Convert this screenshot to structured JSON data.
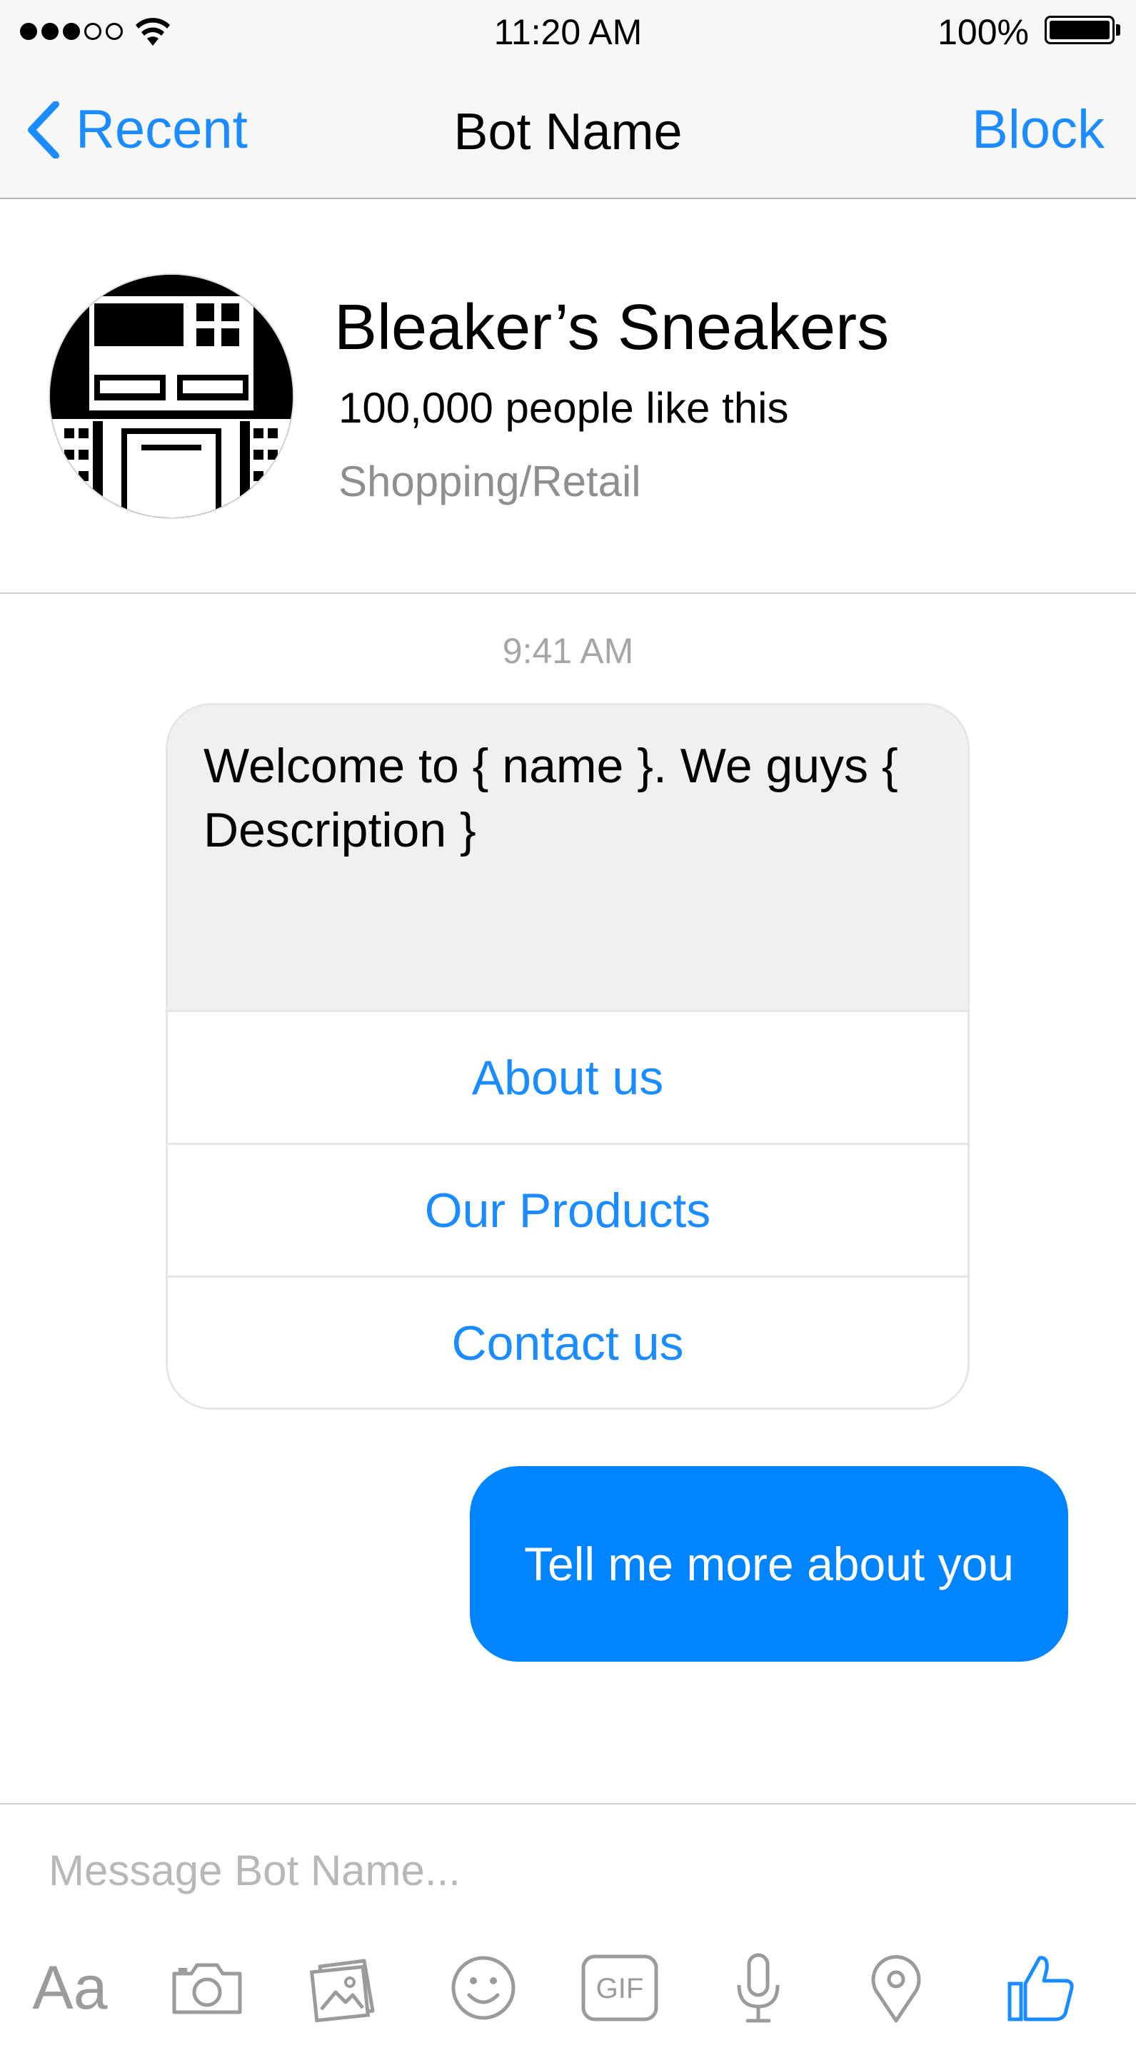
{
  "status_bar": {
    "time": "11:20 AM",
    "battery_percent": "100%",
    "signal_bars_filled": 3,
    "signal_bars_total": 5
  },
  "nav": {
    "back_label": "Recent",
    "title": "Bot Name",
    "action_label": "Block"
  },
  "profile": {
    "name": "Bleaker’s Sneakers",
    "likes": "100,000 people like this",
    "category": "Shopping/Retail"
  },
  "conversation": {
    "timestamp": "9:41 AM",
    "bot_message": "Welcome to { name }. We guys { Description }",
    "bot_buttons": [
      "About us",
      "Our Products",
      "Contact us"
    ],
    "user_message": "Tell me more about you"
  },
  "composer": {
    "placeholder": "Message Bot Name...",
    "text_tool_label": "Aa",
    "icons": [
      "text-format-icon",
      "camera-icon",
      "photo-gallery-icon",
      "emoji-icon",
      "gif-icon",
      "microphone-icon",
      "location-pin-icon",
      "thumbs-up-icon"
    ]
  },
  "colors": {
    "accent": "#1a8cff",
    "user_bubble": "#0084ff",
    "bot_bubble": "#f0f0f0",
    "muted_text": "#8e8e93"
  }
}
